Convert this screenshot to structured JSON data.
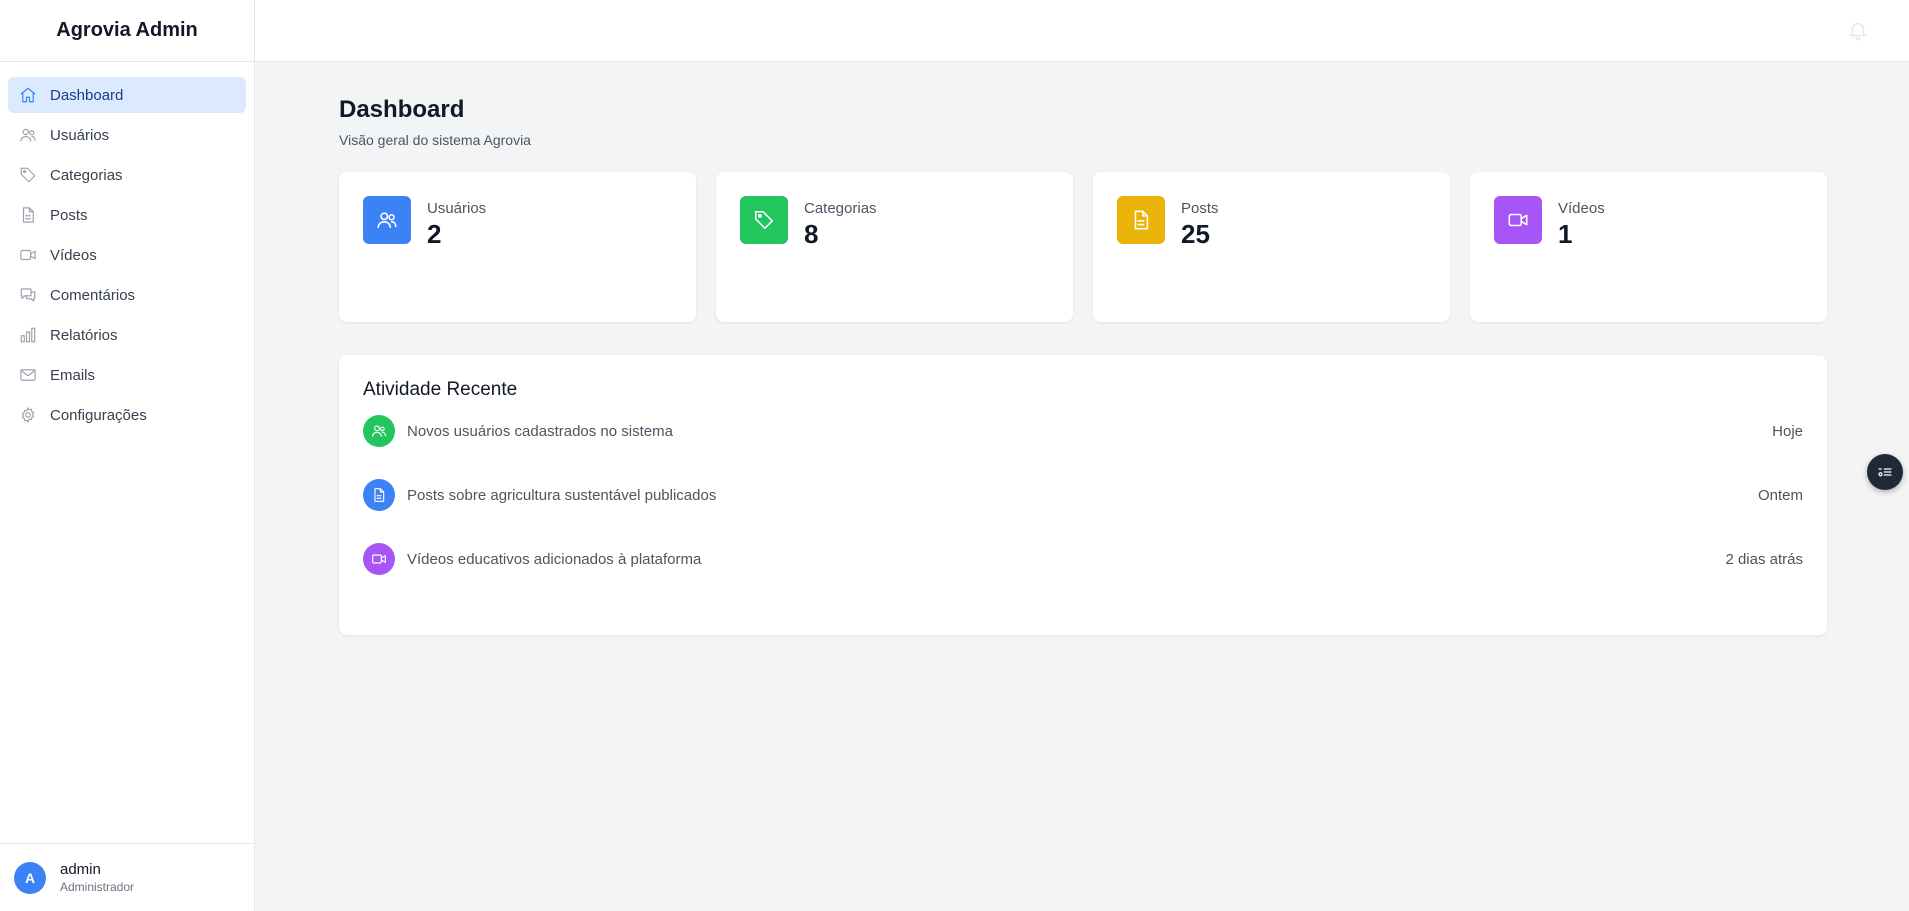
{
  "app": {
    "title": "Agrovia Admin"
  },
  "sidebar": {
    "items": [
      {
        "label": "Dashboard",
        "icon": "home-icon",
        "active": true
      },
      {
        "label": "Usuários",
        "icon": "users-icon"
      },
      {
        "label": "Categorias",
        "icon": "tag-icon"
      },
      {
        "label": "Posts",
        "icon": "file-icon"
      },
      {
        "label": "Vídeos",
        "icon": "video-icon"
      },
      {
        "label": "Comentários",
        "icon": "comments-icon"
      },
      {
        "label": "Relatórios",
        "icon": "bar-chart-icon"
      },
      {
        "label": "Emails",
        "icon": "mail-icon"
      },
      {
        "label": "Configurações",
        "icon": "settings-icon"
      }
    ],
    "user": {
      "initial": "A",
      "name": "admin",
      "role": "Administrador"
    }
  },
  "header": {
    "icon": "bell-icon"
  },
  "main": {
    "title": "Dashboard",
    "subtitle": "Visão geral do sistema Agrovia",
    "stats": [
      {
        "label": "Usuários",
        "value": "2",
        "icon": "users-icon",
        "color": "#3b82f6"
      },
      {
        "label": "Categorias",
        "value": "8",
        "icon": "tag-icon",
        "color": "#22c55e"
      },
      {
        "label": "Posts",
        "value": "25",
        "icon": "file-icon",
        "color": "#eab308"
      },
      {
        "label": "Vídeos",
        "value": "1",
        "icon": "video-icon",
        "color": "#a855f7"
      }
    ],
    "activity": {
      "title": "Atividade Recente",
      "items": [
        {
          "text": "Novos usuários cadastrados no sistema",
          "time": "Hoje",
          "icon": "users-icon",
          "color": "#22c55e"
        },
        {
          "text": "Posts sobre agricultura sustentável publicados",
          "time": "Ontem",
          "icon": "file-icon",
          "color": "#3b82f6"
        },
        {
          "text": "Vídeos educativos adicionados à plataforma",
          "time": "2 dias atrás",
          "icon": "video-icon",
          "color": "#a855f7"
        }
      ]
    }
  },
  "floating_button": {
    "icon": "settings-list-icon",
    "color": "#1f2937"
  }
}
